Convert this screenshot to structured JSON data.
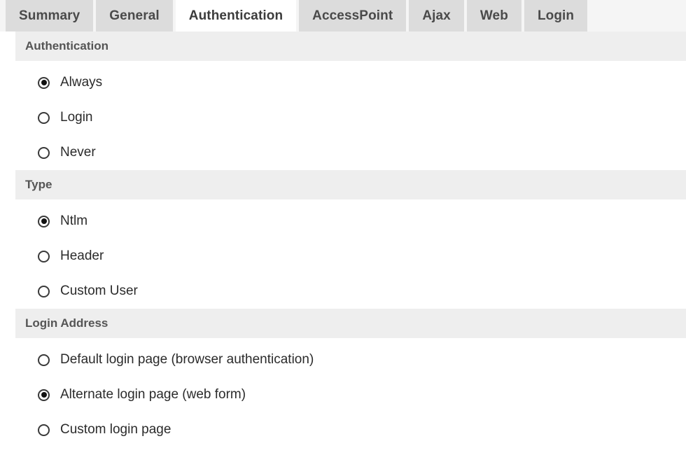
{
  "tabs": [
    {
      "label": "Summary",
      "active": false
    },
    {
      "label": "General",
      "active": false
    },
    {
      "label": "Authentication",
      "active": true
    },
    {
      "label": "AccessPoint",
      "active": false
    },
    {
      "label": "Ajax",
      "active": false
    },
    {
      "label": "Web",
      "active": false
    },
    {
      "label": "Login",
      "active": false
    }
  ],
  "sections": [
    {
      "title": "Authentication",
      "options": [
        {
          "label": "Always",
          "checked": true
        },
        {
          "label": "Login",
          "checked": false
        },
        {
          "label": "Never",
          "checked": false
        }
      ]
    },
    {
      "title": "Type",
      "options": [
        {
          "label": "Ntlm",
          "checked": true
        },
        {
          "label": "Header",
          "checked": false
        },
        {
          "label": "Custom User",
          "checked": false
        }
      ]
    },
    {
      "title": "Login Address",
      "options": [
        {
          "label": "Default login page (browser authentication)",
          "checked": false
        },
        {
          "label": "Alternate login page (web form)",
          "checked": true
        },
        {
          "label": "Custom login page",
          "checked": false
        }
      ]
    }
  ],
  "colors": {
    "tab_inactive_bg": "#dcdcdc",
    "tab_active_bg": "#ffffff",
    "tabbar_bg": "#f5f5f5",
    "section_header_bg": "#eeeeee",
    "section_header_text": "#555555",
    "label_text": "#2b2b2b",
    "radio_border": "#3a3a3a",
    "radio_dot": "#111111"
  }
}
